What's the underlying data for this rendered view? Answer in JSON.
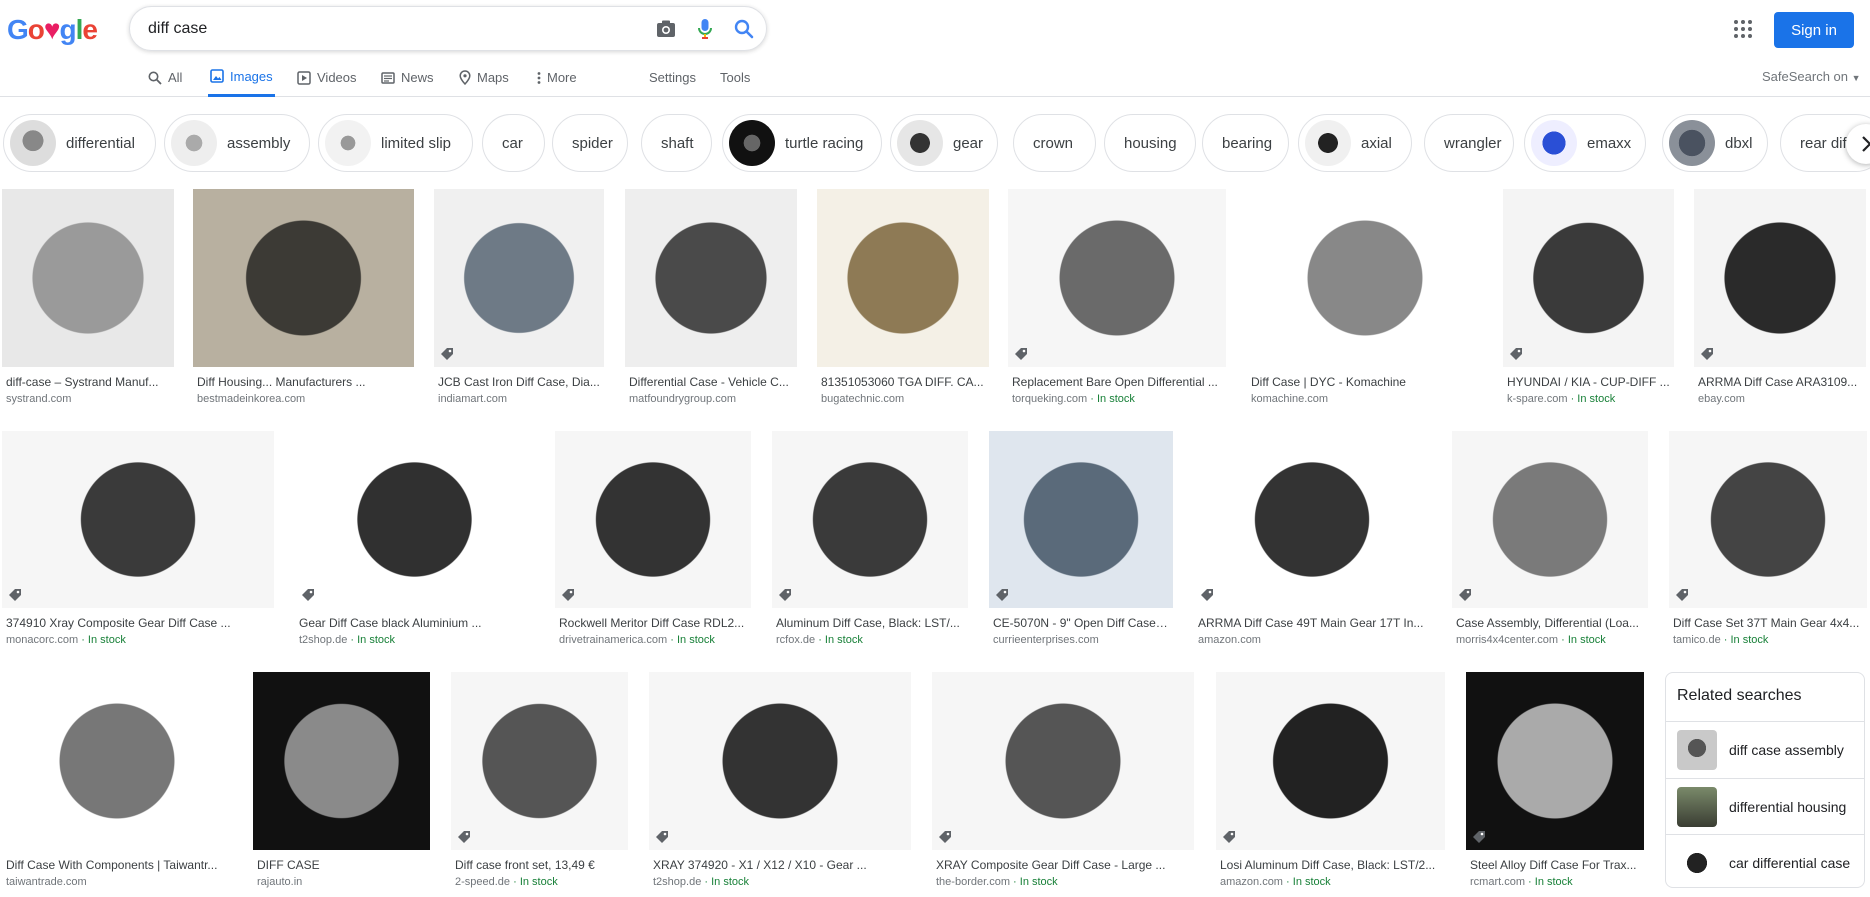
{
  "logo": "Google",
  "search": {
    "value": "diff case"
  },
  "header": {
    "signin": "Sign in"
  },
  "tabs": [
    {
      "label": "All",
      "icon": "search-icon"
    },
    {
      "label": "Images",
      "icon": "image-icon",
      "active": true
    },
    {
      "label": "Videos",
      "icon": "video-icon"
    },
    {
      "label": "News",
      "icon": "news-icon"
    },
    {
      "label": "Maps",
      "icon": "map-pin-icon"
    },
    {
      "label": "More",
      "icon": "more-vertical-icon"
    }
  ],
  "tools": {
    "settings": "Settings",
    "tools": "Tools",
    "safesearch": "SafeSearch on"
  },
  "chips": [
    "differential",
    "assembly",
    "limited slip",
    "car",
    "spider",
    "shaft",
    "turtle racing",
    "gear",
    "crown",
    "housing",
    "bearing",
    "axial",
    "wrangler",
    "emaxx",
    "dbxl",
    "rear diff"
  ],
  "results": [
    {
      "title": "diff-case – Systrand Manuf...",
      "source": "systrand.com",
      "stock": ""
    },
    {
      "title": "Diff Housing... Manufacturers ...",
      "source": "bestmadeinkorea.com",
      "stock": ""
    },
    {
      "title": "JCB Cast Iron Diff Case, Dia...",
      "source": "indiamart.com",
      "stock": ""
    },
    {
      "title": "Differential Case - Vehicle C...",
      "source": "matfoundrygroup.com",
      "stock": ""
    },
    {
      "title": "81351053060 TGA DIFF. CA...",
      "source": "bugatechnic.com",
      "stock": ""
    },
    {
      "title": "Replacement Bare Open Differential ...",
      "source": "torqueking.com",
      "stock": "In stock"
    },
    {
      "title": "Diff Case | DYC - Komachine",
      "source": "komachine.com",
      "stock": ""
    },
    {
      "title": "HYUNDAI / KIA - CUP-DIFF ...",
      "source": "k-spare.com",
      "stock": "In stock"
    },
    {
      "title": "ARRMA Diff Case ARA3109...",
      "source": "ebay.com",
      "stock": ""
    },
    {
      "title": "374910 Xray Composite Gear Diff Case ...",
      "source": "monacorc.com",
      "stock": "In stock"
    },
    {
      "title": "Gear Diff Case black Aluminium ...",
      "source": "t2shop.de",
      "stock": "In stock"
    },
    {
      "title": "Rockwell Meritor Diff Case RDL2...",
      "source": "drivetrainamerica.com",
      "stock": "In stock"
    },
    {
      "title": "Aluminum Diff Case, Black: LST/...",
      "source": "rcfox.de",
      "stock": "In stock"
    },
    {
      "title": "CE-5070N - 9\" Open Diff Case ...",
      "source": "currieenterprises.com",
      "stock": ""
    },
    {
      "title": "ARRMA Diff Case 49T Main Gear 17T In...",
      "source": "amazon.com",
      "stock": ""
    },
    {
      "title": "Case Assembly, Differential (Loa...",
      "source": "morris4x4center.com",
      "stock": "In stock"
    },
    {
      "title": "Diff Case Set 37T Main Gear 4x4...",
      "source": "tamico.de",
      "stock": "In stock"
    },
    {
      "title": "Diff Case With Components | Taiwantr...",
      "source": "taiwantrade.com",
      "stock": ""
    },
    {
      "title": "DIFF CASE",
      "source": "rajauto.in",
      "stock": ""
    },
    {
      "title": "Diff case front set, 13,49 €",
      "source": "2-speed.de",
      "stock": "In stock"
    },
    {
      "title": "XRAY 374920 - X1 / X12 / X10 - Gear ...",
      "source": "t2shop.de",
      "stock": "In stock"
    },
    {
      "title": "XRAY Composite Gear Diff Case - Large ...",
      "source": "the-border.com",
      "stock": "In stock"
    },
    {
      "title": "Losi Aluminum Diff Case, Black: LST/2...",
      "source": "amazon.com",
      "stock": "In stock"
    },
    {
      "title": "Steel Alloy Diff Case For Trax...",
      "source": "rcmart.com",
      "stock": "In stock"
    }
  ],
  "related": {
    "title": "Related searches",
    "items": [
      "diff case assembly",
      "differential housing",
      "car differential case"
    ]
  },
  "colors": {
    "accent": "#1a73e8",
    "stock": "#188038"
  }
}
